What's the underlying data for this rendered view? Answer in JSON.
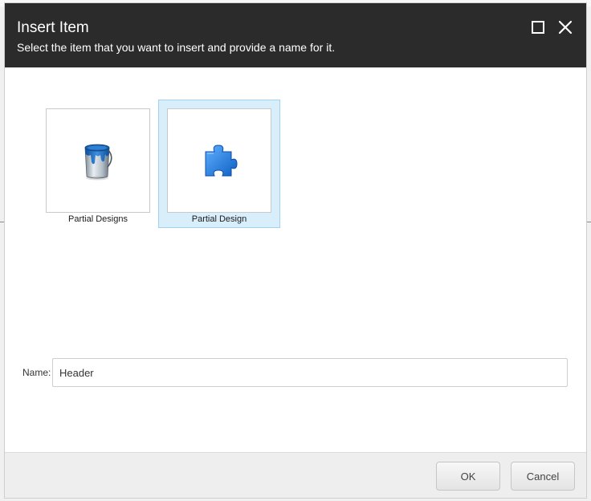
{
  "dialog": {
    "title": "Insert Item",
    "subtitle": "Select the item that you want to insert and provide a name for it."
  },
  "window_controls": {
    "maximize_icon": "maximize-icon",
    "close_icon": "close-icon"
  },
  "items": [
    {
      "label": "Partial Designs",
      "icon": "paint-bucket-icon",
      "selected": false
    },
    {
      "label": "Partial Design",
      "icon": "puzzle-piece-icon",
      "selected": true
    }
  ],
  "name_field": {
    "label": "Name:",
    "value": "Header"
  },
  "footer": {
    "ok_label": "OK",
    "cancel_label": "Cancel"
  },
  "colors": {
    "header_bg": "#2b2b2b",
    "selection_bg": "#d8eefb",
    "selection_border": "#9fd3f1",
    "icon_blue": "#1e73d6"
  }
}
